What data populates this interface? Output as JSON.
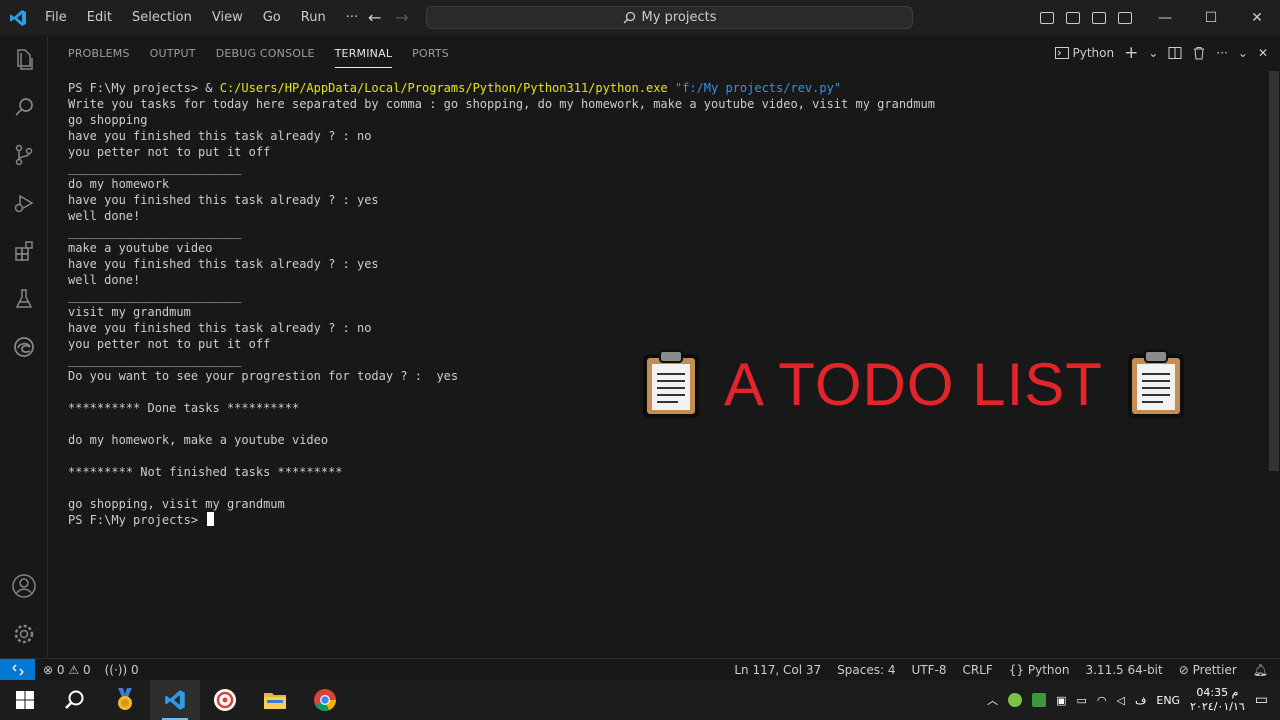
{
  "titlebar": {
    "menu": [
      "File",
      "Edit",
      "Selection",
      "View",
      "Go",
      "Run",
      "···"
    ],
    "search_text": "My projects"
  },
  "activity_icons": [
    "explorer-icon",
    "search-icon",
    "source-control-icon",
    "run-debug-icon",
    "extensions-icon",
    "testing-icon",
    "edge-tools-icon",
    "accounts-icon",
    "manage-gear-icon"
  ],
  "panel": {
    "tabs": [
      "PROBLEMS",
      "OUTPUT",
      "DEBUG CONSOLE",
      "TERMINAL",
      "PORTS"
    ],
    "active_tab": "TERMINAL",
    "terminal_kind": "Python"
  },
  "terminal": {
    "cmd_prompt": "PS F:\\My projects> & ",
    "cmd_exe": "C:/Users/HP/AppData/Local/Programs/Python/Python311/python.exe",
    "cmd_arg": " \"f:/My projects/rev.py\"",
    "lines": [
      "Write you tasks for today here separated by comma : go shopping, do my homework, make a youtube video, visit my grandmum",
      "go shopping",
      "have you finished this task already ? : no",
      "you petter not to put it off",
      "________________________",
      "do my homework",
      "have you finished this task already ? : yes",
      "well done!",
      "________________________",
      "make a youtube video",
      "have you finished this task already ? : yes",
      "well done!",
      "________________________",
      "visit my grandmum",
      "have you finished this task already ? : no",
      "you petter not to put it off",
      "________________________",
      "Do you want to see your progrestion for today ? :  yes",
      "",
      "********** Done tasks **********",
      "",
      "do my homework, make a youtube video",
      "",
      "********* Not finished tasks *********",
      "",
      "go shopping, visit my grandmum"
    ],
    "final_prompt": "PS F:\\My projects> "
  },
  "overlay": {
    "title": "A TODO LIST",
    "title_color": "#e3242b"
  },
  "statusbar": {
    "errors": "0",
    "warnings": "0",
    "ports": "0",
    "position": "Ln 117, Col 37",
    "spaces": "Spaces: 4",
    "encoding": "UTF-8",
    "eol": "CRLF",
    "language": "Python",
    "interpreter": "3.11.5 64-bit",
    "formatter": "Prettier"
  },
  "taskbar": {
    "lang": "ENG",
    "time": "04:35 م",
    "date": "٢٠٢٤/٠١/١٦"
  },
  "colors": {
    "accent": "#0078d4",
    "terminal_path": "#e5e510",
    "terminal_string": "#3b8eea"
  }
}
